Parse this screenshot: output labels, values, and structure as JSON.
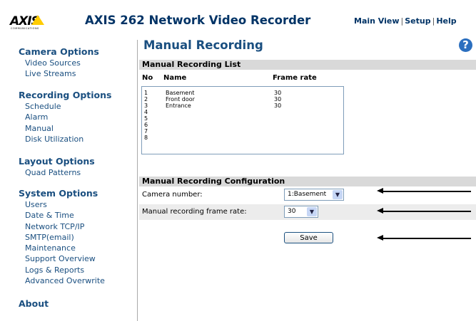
{
  "header": {
    "logo_text": "AXIS",
    "logo_sub": "COMMUNICATIONS",
    "app_title": "AXIS 262 Network Video Recorder",
    "nav": [
      "Main View",
      "Setup",
      "Help"
    ]
  },
  "sidebar": {
    "sections": [
      {
        "title": "Camera Options",
        "items": [
          "Video Sources",
          "Live Streams"
        ]
      },
      {
        "title": "Recording Options",
        "items": [
          "Schedule",
          "Alarm",
          "Manual",
          "Disk Utilization"
        ]
      },
      {
        "title": "Layout Options",
        "items": [
          "Quad Patterns"
        ]
      },
      {
        "title": "System Options",
        "items": [
          "Users",
          "Date & Time",
          "Network TCP/IP",
          "SMTP(email)",
          "Maintenance",
          "Support Overview",
          "Logs & Reports",
          "Advanced Overwrite"
        ]
      },
      {
        "title": "About",
        "items": []
      }
    ]
  },
  "main": {
    "title": "Manual Recording",
    "list_section_title": "Manual Recording List",
    "columns": {
      "no": "No",
      "name": "Name",
      "frame_rate": "Frame rate"
    },
    "rows": [
      {
        "no": "1",
        "name": "Basement",
        "frame_rate": "30"
      },
      {
        "no": "2",
        "name": "Front door",
        "frame_rate": "30"
      },
      {
        "no": "3",
        "name": "Entrance",
        "frame_rate": "30"
      },
      {
        "no": "4",
        "name": "",
        "frame_rate": ""
      },
      {
        "no": "5",
        "name": "",
        "frame_rate": ""
      },
      {
        "no": "6",
        "name": "",
        "frame_rate": ""
      },
      {
        "no": "7",
        "name": "",
        "frame_rate": ""
      },
      {
        "no": "8",
        "name": "",
        "frame_rate": ""
      }
    ],
    "config_section_title": "Manual Recording Configuration",
    "camera_number_label": "Camera number:",
    "camera_number_value": "1:Basement",
    "frame_rate_label": "Manual recording frame rate:",
    "frame_rate_value": "30",
    "save_label": "Save"
  }
}
